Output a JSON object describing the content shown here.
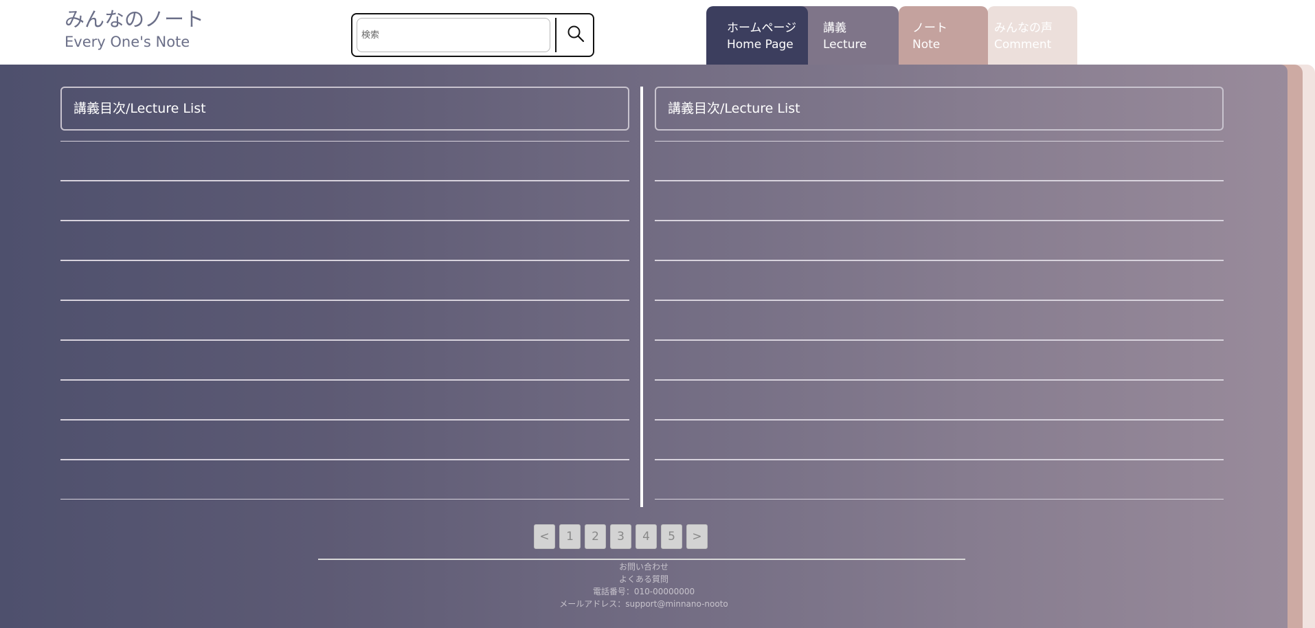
{
  "logo": {
    "title_jp": "みんなのノート",
    "title_en": "Every One's Note"
  },
  "search": {
    "placeholder": "検索",
    "icon": "search-icon"
  },
  "nav": {
    "tabs": [
      {
        "label_jp": "ホームページ",
        "label_en": "Home Page",
        "color": "#3c3e5e"
      },
      {
        "label_jp": "講義",
        "label_en": "Lecture",
        "color": "#7f7589"
      },
      {
        "label_jp": "ノート",
        "label_en": "Note",
        "color": "#c4a29e"
      },
      {
        "label_jp": "みんなの声",
        "label_en": "Comment",
        "color": "#ecdfdb"
      }
    ]
  },
  "columns": [
    {
      "title": "講義目次/Lecture List",
      "rows": [
        "",
        "",
        "",
        "",
        "",
        "",
        "",
        "",
        ""
      ]
    },
    {
      "title": "講義目次/Lecture List",
      "rows": [
        "",
        "",
        "",
        "",
        "",
        "",
        "",
        "",
        ""
      ]
    }
  ],
  "pagination": {
    "prev": "<",
    "pages": [
      "1",
      "2",
      "3",
      "4",
      "5"
    ],
    "next": ">"
  },
  "footer": {
    "contact": "お問い合わせ",
    "faq": "よくある質問",
    "phone": "電話番号：010-00000000",
    "email": "メールアドレス：support@minnano-nooto"
  },
  "colors": {
    "gradient_start": "#4e506d",
    "gradient_end": "#998b9b"
  }
}
